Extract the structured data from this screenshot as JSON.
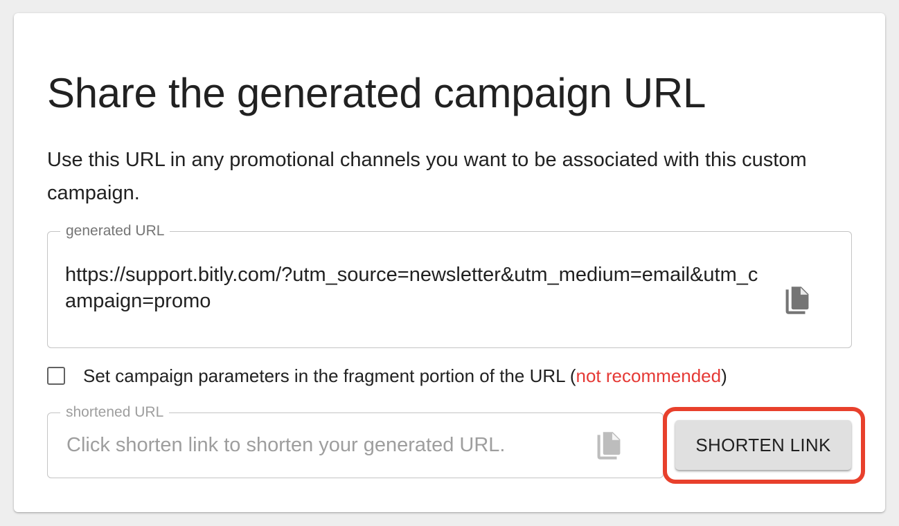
{
  "card": {
    "title": "Share the generated campaign URL",
    "description": "Use this URL in any promotional channels you want to be associated with this custom campaign."
  },
  "generated_url": {
    "label": "generated URL",
    "value": "https://support.bitly.com/?utm_source=newsletter&utm_medium=email&utm_campaign=promo",
    "copy_icon": "copy-icon"
  },
  "fragment_option": {
    "checked": false,
    "label": "Set campaign parameters in the fragment portion of the URL (",
    "warning": "not recommended",
    "label_end": ")"
  },
  "shortened_url": {
    "label": "shortened URL",
    "placeholder": "Click shorten link to shorten your generated URL.",
    "copy_icon": "copy-icon"
  },
  "shorten_button": {
    "label": "SHORTEN LINK"
  },
  "colors": {
    "warning": "#e53935",
    "highlight": "#e8402c",
    "button_bg": "#e0e0e0"
  }
}
